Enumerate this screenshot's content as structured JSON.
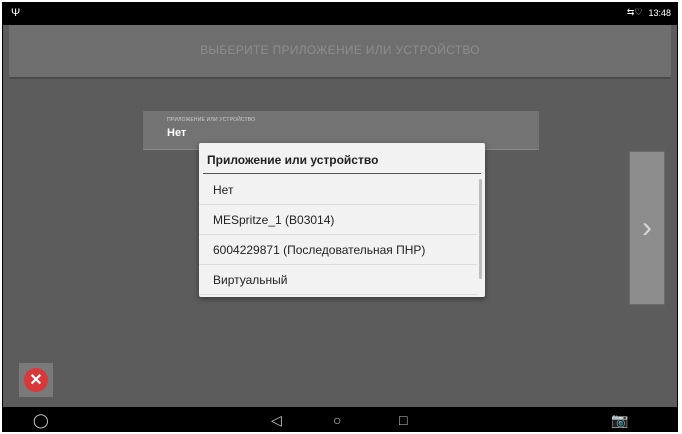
{
  "status_bar": {
    "left_icon": "usb-icon",
    "right_icons": "signal-wifi-icons",
    "time": "13:48"
  },
  "header": {
    "title": "ВЫБЕРИТЕ ПРИЛОЖЕНИЕ ИЛИ УСТРОЙСТВО"
  },
  "selector": {
    "label": "ПРИЛОЖЕНИЕ ИЛИ УСТРОЙСТВО",
    "value": "Нет"
  },
  "dialog": {
    "title": "Приложение или устройство",
    "options": [
      {
        "label": "Нет"
      },
      {
        "label": "MESpritze_1 (B03014)"
      },
      {
        "label": "6004229871 (Последовательная ПНР)"
      },
      {
        "label": "Виртуальный"
      }
    ]
  },
  "buttons": {
    "next_icon": "chevron-right-icon",
    "cancel_icon": "cancel-icon"
  },
  "nav_bar": {
    "items": [
      "brand-logo-icon",
      "back-icon",
      "home-icon",
      "recents-icon",
      "screenshot-icon"
    ]
  },
  "colors": {
    "background": "#5c5c5c",
    "header": "#6e6e6e",
    "dialog": "#f2f2f2",
    "cancel": "#d8383a"
  }
}
